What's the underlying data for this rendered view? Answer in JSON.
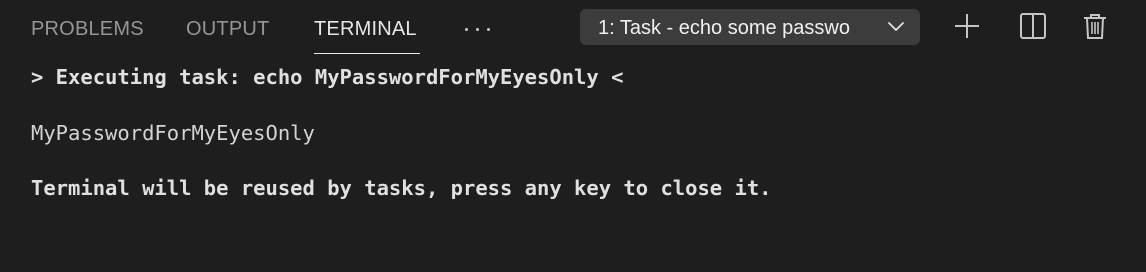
{
  "tabs": [
    {
      "label": "PROBLEMS"
    },
    {
      "label": "OUTPUT"
    },
    {
      "label": "TERMINAL"
    }
  ],
  "active_tab": "TERMINAL",
  "terminal_selector": {
    "selected": "1: Task - echo some passwo"
  },
  "actions": {
    "new_terminal": "plus-icon",
    "split_terminal": "split-icon",
    "kill_terminal": "trash-icon",
    "more": "ellipsis-icon"
  },
  "terminal": {
    "lines": [
      "> Executing task: echo MyPasswordForMyEyesOnly <",
      "MyPasswordForMyEyesOnly",
      "Terminal will be reused by tasks, press any key to close it."
    ]
  },
  "colors": {
    "background": "#1e1e1e",
    "tab_inactive": "#969696",
    "tab_active": "#e7e7e7",
    "dropdown_bg": "#3c3c3c",
    "terminal_text": "#d4d4d4"
  }
}
